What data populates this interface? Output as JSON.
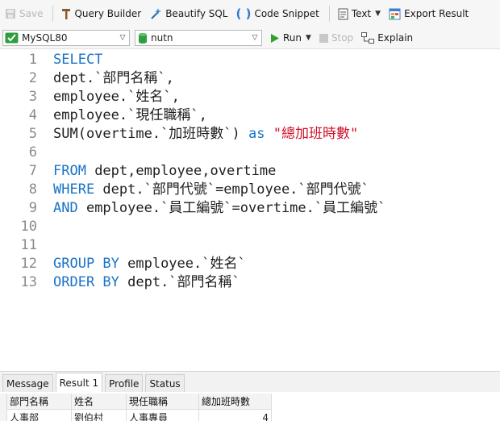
{
  "toolbar": {
    "save_label": "Save",
    "query_builder_label": "Query Builder",
    "beautify_label": "Beautify SQL",
    "code_snippet_label": "Code Snippet",
    "text_label": "Text",
    "export_label": "Export Result"
  },
  "connection": {
    "server": "MySQL80",
    "database": "nutn",
    "run_label": "Run",
    "stop_label": "Stop",
    "explain_label": "Explain"
  },
  "editor": {
    "lines": [
      {
        "n": "1",
        "segs": [
          {
            "t": "SELECT",
            "k": "kw"
          }
        ]
      },
      {
        "n": "2",
        "segs": [
          {
            "t": "dept.`部門名稱`,",
            "k": ""
          }
        ]
      },
      {
        "n": "3",
        "segs": [
          {
            "t": "employee.`姓名`,",
            "k": ""
          }
        ]
      },
      {
        "n": "4",
        "segs": [
          {
            "t": "employee.`現任職稱`,",
            "k": ""
          }
        ]
      },
      {
        "n": "5",
        "segs": [
          {
            "t": "SUM(overtime.`加班時數`) ",
            "k": ""
          },
          {
            "t": "as",
            "k": "kw"
          },
          {
            "t": " ",
            "k": ""
          },
          {
            "t": "\"總加班時數\"",
            "k": "str"
          }
        ]
      },
      {
        "n": "6",
        "segs": []
      },
      {
        "n": "7",
        "segs": [
          {
            "t": "FROM",
            "k": "kw"
          },
          {
            "t": " dept,employee,overtime",
            "k": ""
          }
        ]
      },
      {
        "n": "8",
        "segs": [
          {
            "t": "WHERE",
            "k": "kw"
          },
          {
            "t": " dept.`部門代號`=employee.`部門代號`",
            "k": ""
          }
        ]
      },
      {
        "n": "9",
        "segs": [
          {
            "t": "AND",
            "k": "kw"
          },
          {
            "t": " employee.`員工編號`=overtime.`員工編號`",
            "k": ""
          }
        ]
      },
      {
        "n": "10",
        "segs": []
      },
      {
        "n": "11",
        "segs": []
      },
      {
        "n": "12",
        "segs": [
          {
            "t": "GROUP BY",
            "k": "kw"
          },
          {
            "t": " employee.`姓名`",
            "k": ""
          }
        ]
      },
      {
        "n": "13",
        "segs": [
          {
            "t": "ORDER BY",
            "k": "kw"
          },
          {
            "t": " dept.`部門名稱`",
            "k": ""
          }
        ]
      }
    ]
  },
  "result_tabs": [
    {
      "label": "Message",
      "active": false
    },
    {
      "label": "Result 1",
      "active": true
    },
    {
      "label": "Profile",
      "active": false
    },
    {
      "label": "Status",
      "active": false
    }
  ],
  "grid": {
    "headers": [
      "部門名稱",
      "姓名",
      "現任職稱",
      "總加班時數"
    ],
    "rows": [
      [
        "人事部",
        "劉伯村",
        "人事專員",
        "4"
      ]
    ]
  },
  "colors": {
    "keyword": "#1a73c7",
    "string": "#d0102a",
    "run_green": "#2ea12e"
  }
}
